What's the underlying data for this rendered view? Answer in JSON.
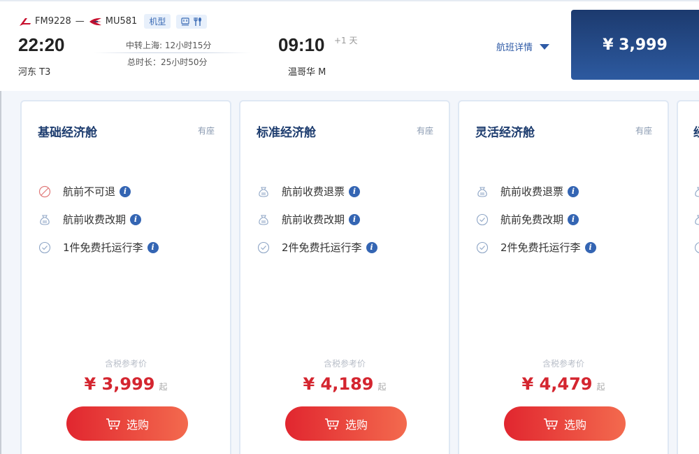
{
  "flight": {
    "flight1": "FM9228",
    "separator": "—",
    "flight2": "MU581",
    "aircraft_tag": "机型",
    "dep_time": "22:20",
    "dep_airport": "河东 T3",
    "transfer": "中转上海: 12小时15分",
    "duration": "总时长：25小时50分",
    "arr_time": "09:10",
    "plus_day": "+1 天",
    "arr_airport": "温哥华 M",
    "detail_label": "航班详情",
    "price": "¥ 3,999",
    "brand_color": "#c8102e",
    "price_box_color": "#1c3a6e"
  },
  "cards": [
    {
      "title": "基础经济舱",
      "seat": "有座",
      "features": [
        {
          "icon": "no-refund-icon",
          "text": "航前不可退"
        },
        {
          "icon": "fee-bag-icon",
          "text": "航前收费改期"
        },
        {
          "icon": "check-circle-icon",
          "text": "1件免费托运行李"
        }
      ],
      "ref_label": "含税参考价",
      "price": "¥ 3,999",
      "price_suffix": "起",
      "buy_label": "选购"
    },
    {
      "title": "标准经济舱",
      "seat": "有座",
      "features": [
        {
          "icon": "fee-bag-icon",
          "text": "航前收费退票"
        },
        {
          "icon": "fee-bag-icon",
          "text": "航前收费改期"
        },
        {
          "icon": "check-circle-icon",
          "text": "2件免费托运行李"
        }
      ],
      "ref_label": "含税参考价",
      "price": "¥ 4,189",
      "price_suffix": "起",
      "buy_label": "选购"
    },
    {
      "title": "灵活经济舱",
      "seat": "有座",
      "features": [
        {
          "icon": "fee-bag-icon",
          "text": "航前收费退票"
        },
        {
          "icon": "check-circle-icon",
          "text": "航前免费改期"
        },
        {
          "icon": "check-circle-icon",
          "text": "2件免费托运行李"
        }
      ],
      "ref_label": "含税参考价",
      "price": "¥ 4,479",
      "price_suffix": "起",
      "buy_label": "选购"
    }
  ],
  "partial_card_title": "经"
}
